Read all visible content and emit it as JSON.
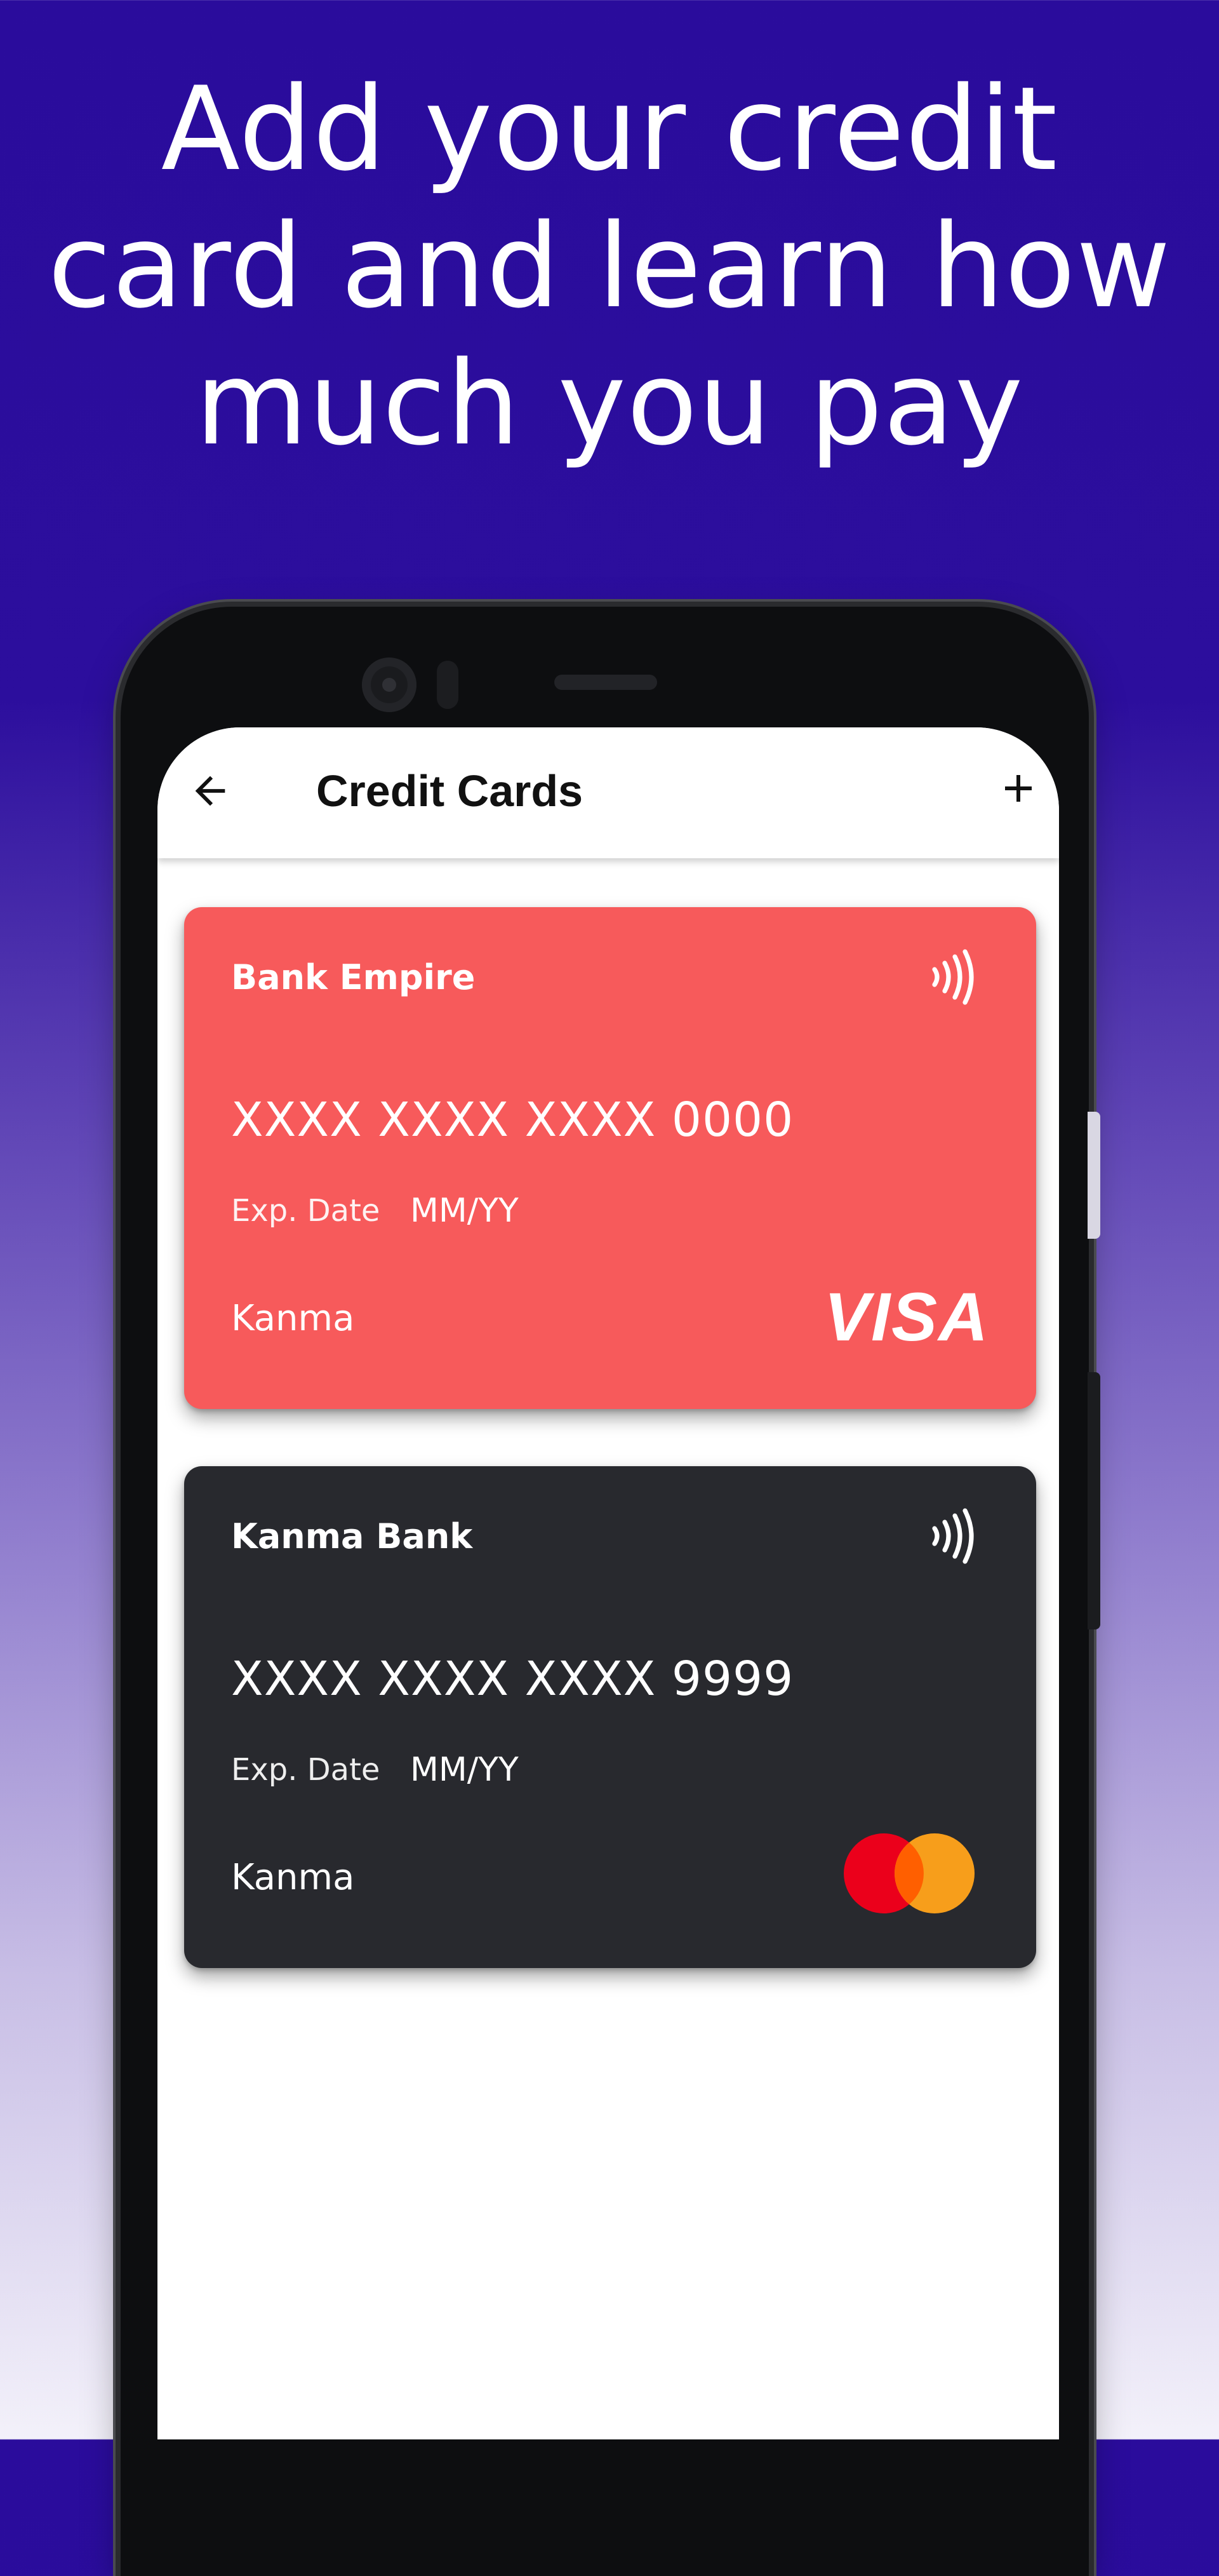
{
  "headline": {
    "lines": [
      "Add your credit",
      "card and learn how",
      "much you pay"
    ]
  },
  "appbar": {
    "title": "Credit Cards",
    "back_icon": "arrow-left-icon",
    "add_icon": "plus-icon"
  },
  "cards": [
    {
      "bank": "Bank Empire",
      "number": "XXXX XXXX XXXX 0000",
      "exp_label": "Exp. Date",
      "exp_value": "MM/YY",
      "holder": "Kanma",
      "network": "VISA",
      "color": "#f75a5b"
    },
    {
      "bank": "Kanma Bank",
      "number": "XXXX XXXX XXXX 9999",
      "exp_label": "Exp. Date",
      "exp_value": "MM/YY",
      "holder": "Kanma",
      "network_icon": "mastercard-logo-icon",
      "color": "#28292e"
    }
  ],
  "colors": {
    "background_top": "#2a0c9c",
    "background_bottom": "#f3f1fa",
    "mastercard_red": "#eb001b",
    "mastercard_orange": "#f79e1b"
  }
}
